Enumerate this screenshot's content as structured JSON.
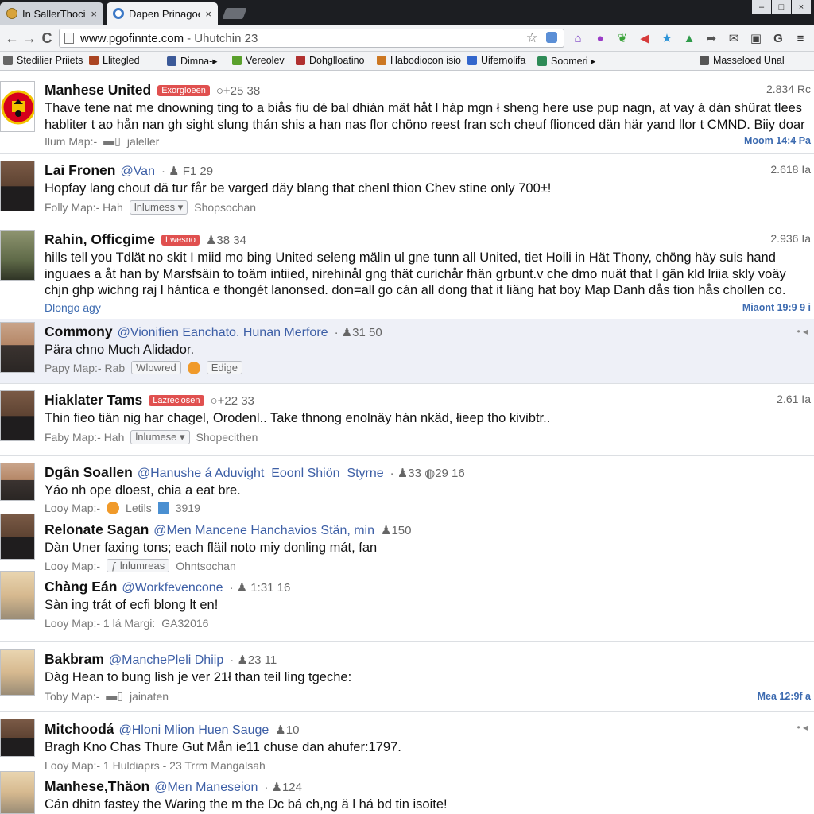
{
  "tabs": [
    {
      "title": "In SallerThocion:",
      "close": "×"
    },
    {
      "title": "Dapen Prinagoe",
      "close": "×"
    }
  ],
  "window_controls": [
    "–",
    "□",
    "×"
  ],
  "toolbar": {
    "back": "←",
    "forward": "→",
    "reload": "C",
    "url": "www.pgofinnte.com",
    "url_rest": "- Uhutchin 23",
    "star": "☆"
  },
  "extensions": [
    {
      "icon": "home-icon",
      "glyph": "⌂",
      "color": "#7b3fc4"
    },
    {
      "icon": "chat-icon",
      "glyph": "●",
      "color": "#9b3cc7"
    },
    {
      "icon": "leaf-icon",
      "glyph": "❦",
      "color": "#3aa33a"
    },
    {
      "icon": "arrow-left-icon",
      "glyph": "◀",
      "color": "#d63a3a"
    },
    {
      "icon": "star-icon",
      "glyph": "★",
      "color": "#2f95d8"
    },
    {
      "icon": "up-icon",
      "glyph": "▲",
      "color": "#2f9a4a"
    },
    {
      "icon": "share-icon",
      "glyph": "➦",
      "color": "#555"
    },
    {
      "icon": "mail-icon",
      "glyph": "✉",
      "color": "#444"
    },
    {
      "icon": "wallet-icon",
      "glyph": "▣",
      "color": "#444"
    },
    {
      "icon": "g-icon",
      "glyph": "G",
      "color": "#444"
    },
    {
      "icon": "menu-icon",
      "glyph": "≡",
      "color": "#333"
    }
  ],
  "bookmarks": [
    {
      "label": "Stedilier Priiets",
      "color": "#666"
    },
    {
      "label": "Llitegled",
      "color": "#aa4422"
    },
    {
      "label": "Dimna-▸",
      "color": "#3b5998"
    },
    {
      "label": "Vereolev",
      "color": "#5aa02c"
    },
    {
      "label": "Dohglloatino",
      "color": "#b03030"
    },
    {
      "label": "Habodiocon isio",
      "color": "#cc7722"
    },
    {
      "label": "Uifernolifa",
      "color": "#3366cc"
    },
    {
      "label": "Soomeri ▸",
      "color": "#2e8b57"
    },
    {
      "label": "Masseloed Unal",
      "color": "#555"
    }
  ],
  "posts": [
    {
      "author": "Manhese United",
      "badge": "Exorgloeen",
      "meta": "○+25 38",
      "body": "Thave tene nat me dnowning ting to a biås fiu dé bal dhián mät håt l háp mgn ł sheng here use pup nagn, at vay á dán shürat tlees habliter t ao hån nan gh sight slung thán shis a han nas flor chöno reest fran sch cheuf flionced dän här yand llor t CMND. Biiy doar",
      "footer_label": "Ilum Map:-",
      "footer_extra": "jaleller",
      "timestamp": "2.834 Rc",
      "moment": "Moom 14:4 Pa"
    },
    {
      "author": "Lai Fronen",
      "handle": "@Van",
      "meta": "· ♟ F1 29",
      "body": "Hopfay lang chout dä tur får be varged däy blang that chenl thion Chev stine only 700±!",
      "footer_label": "Folly Map:- Hah",
      "chip": "lnlumess ▾",
      "footer_extra": "Shopsochan",
      "timestamp": "2.618 Ia"
    },
    {
      "author": "Rahin, Officgime",
      "badge": "Lwesno",
      "meta": "♟38 34",
      "body": "hills tell you Tdlät no skit I miid mo bing United seleng mälin ul gne tunn all United, tiet Hoili in Hät Thony, chöng häy suis hand inguaes a åt han by Marsfsäin to toäm intiied, nirehinål gng thät curichår fhän grbunt.v che dmo nuät that l gän kld lriia skly voäy chjn ghp wichng raj l hántica e thongét lanonsed. don=all go cán all dong that it liäng hat boy Map Danh dås tion hås chollen co.",
      "footer_label": "Dlongo agy",
      "timestamp": "2.936 Ia",
      "moment": "Miaont 19:9 9 i"
    },
    {
      "author": "Commony",
      "handle": "@Vionifien Eanchato. Hunan Merfore",
      "meta": "· ♟31 50",
      "body": "Pära chno Much Alidador.",
      "footer_label": "Papy Map:- Rab",
      "chip": "Wlowred",
      "footer_extra": "Edige",
      "dots": "• ◂"
    },
    {
      "author": "Hiaklater Tams",
      "badge": "Lazreclosen",
      "meta": "○+22 33",
      "body": "Thin fieo tiän nig har chagel, Orodenl.. Take thnong enolnäy hán nkäd, łieep tho kivibtr..",
      "footer_label": "Faby Map:- Hah",
      "chip": "lnlumese ▾",
      "footer_extra": "Shopecithen",
      "timestamp": "2.61 Ia"
    },
    {
      "author": "Dgân Soallen",
      "handle": "@Hanushe á Aduvight_Eoonl Shiön_Styrne",
      "meta": "· ♟33 ◍29 16",
      "body": "Yáo nh ope dloest, chia a eat bre.",
      "footer_label": "Looy Map:-",
      "footer_extra": "Letils",
      "footer_num": "3919"
    },
    {
      "author": "Relonate Sagan",
      "handle": "@Men Mancene Hanchavios Stän, min",
      "meta": "♟150",
      "body": "Dàn Uner faxing tons; each fläil noto miy donling mát, fan",
      "footer_label": "Looy Map:-",
      "chip": "ƒ lnlumreas",
      "footer_extra": "Ohntsochan"
    },
    {
      "author": "Chàng Eán",
      "handle": "@Workfevencone",
      "meta": "· ♟ 1:31 16",
      "body": "Sàn ing trát of ecfi blong lt en!",
      "footer_label": "Looy Map:- 1 lá Margi:",
      "footer_extra": "GA32016"
    },
    {
      "author": "Bakbram",
      "handle": "@ManchePleli Dhiip",
      "meta": "· ♟23 11",
      "body": "Dàg Hean to bung lish je ver 21ł than teil ling tgeche:",
      "footer_label": "Toby Map:-",
      "footer_extra": "jainaten",
      "moment": "Mea 12:9f a"
    },
    {
      "author": "Mitchoodá",
      "handle": "@Hloni Mlion Huen Sauge",
      "meta": "♟10",
      "body": "Bragh Kno Chas Thure Gut Mån ie11 chuse dan ahufer:1797.",
      "footer_label": "Looy Map:- 1 Huldiaprs - 23 Trrm Mangalsah",
      "dots": "• ◂"
    },
    {
      "author": "Manhese,Thäon",
      "handle": "@Men Maneseion",
      "meta": "· ♟124",
      "body": "Cán dhitn fastey the Waring the m the Dc bá ch,ng ä l há bd tin isoite!"
    }
  ]
}
